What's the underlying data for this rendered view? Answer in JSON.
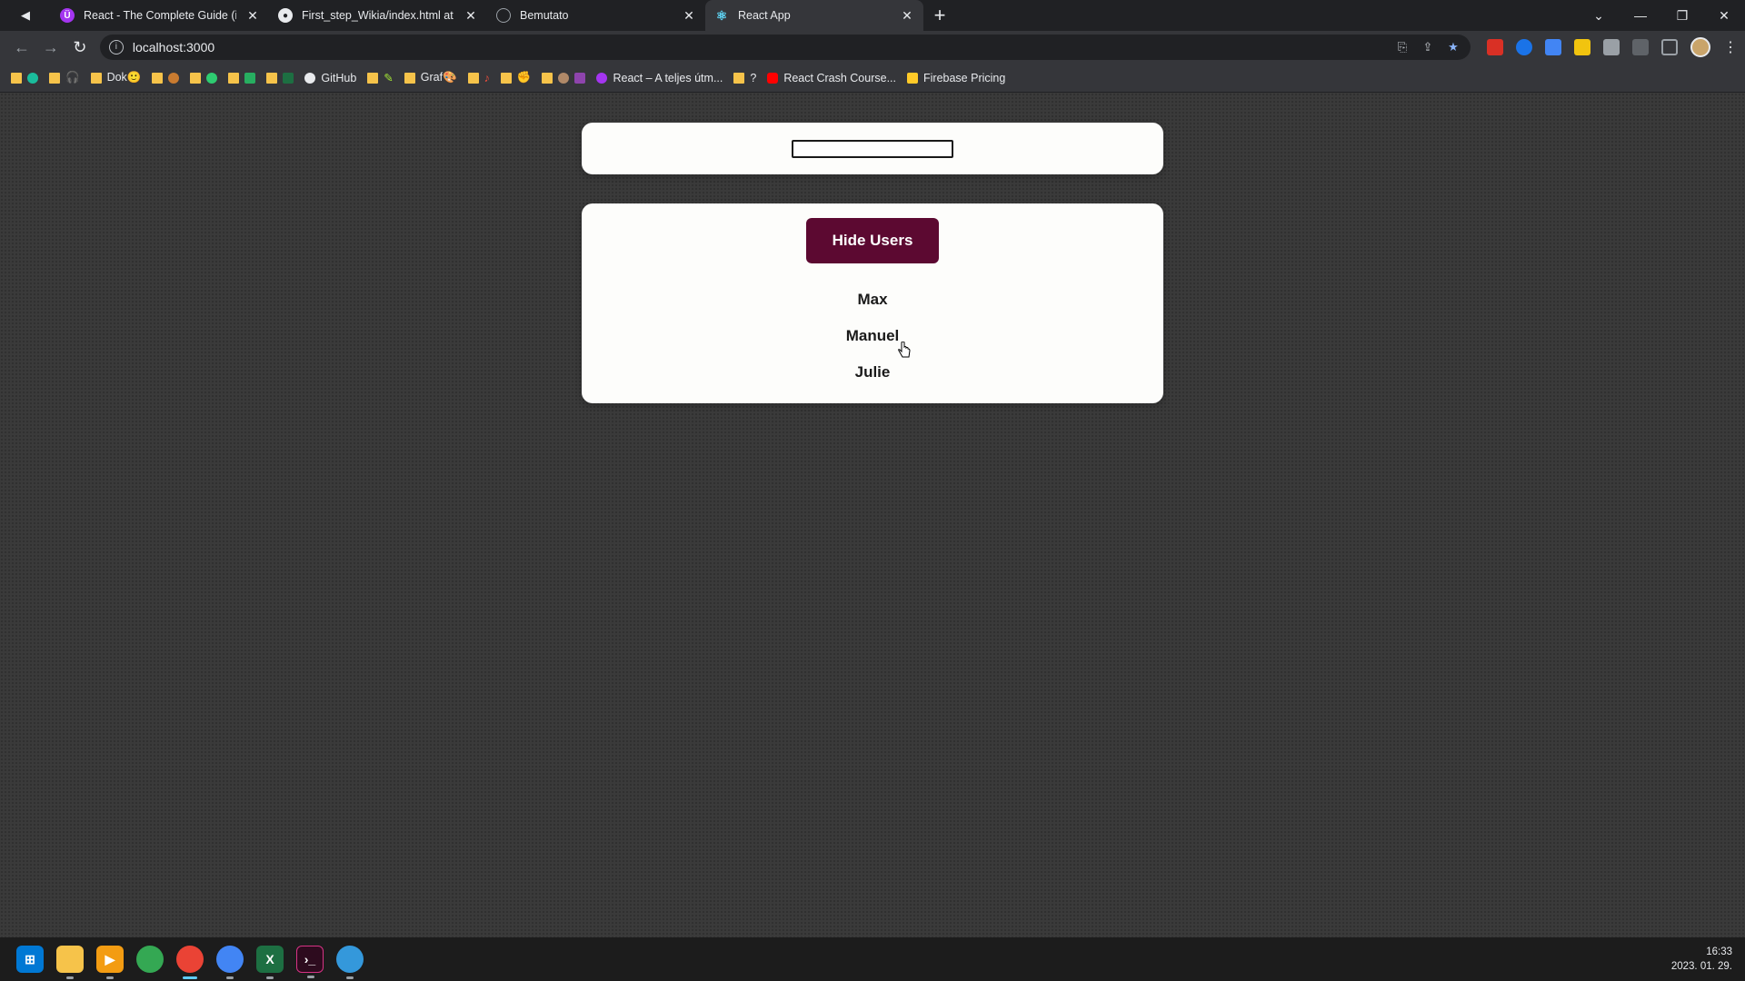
{
  "browser": {
    "tabs": [
      {
        "title": "React - The Complete Guide (incl",
        "favicon_color": "#a435f0"
      },
      {
        "title": "First_step_Wikia/index.html at m",
        "favicon_color": "#e8eaed"
      },
      {
        "title": "Bemutato",
        "favicon_color": "#9aa0a6"
      },
      {
        "title": "React App",
        "favicon_color": "#61dafb"
      }
    ],
    "active_tab": 3,
    "new_tab_label": "+",
    "url": "localhost:3000",
    "bookmarks": [
      {
        "label": "Dok🙂",
        "type": "folder"
      },
      {
        "label": "GitHub",
        "type": "link"
      },
      {
        "label": "Graf🎨",
        "type": "folder"
      },
      {
        "label": "?",
        "type": "folder"
      },
      {
        "label": "React – A teljes útm...",
        "type": "link"
      },
      {
        "label": "React Crash Course...",
        "type": "link"
      },
      {
        "label": "Firebase Pricing",
        "type": "link"
      }
    ]
  },
  "app": {
    "search": {
      "value": ""
    },
    "toggle_button_label": "Hide Users",
    "users": [
      "Max",
      "Manuel",
      "Julie"
    ],
    "accent_color": "#5c0931"
  },
  "taskbar": {
    "time": "16:33",
    "date": "2023. 01. 29."
  }
}
